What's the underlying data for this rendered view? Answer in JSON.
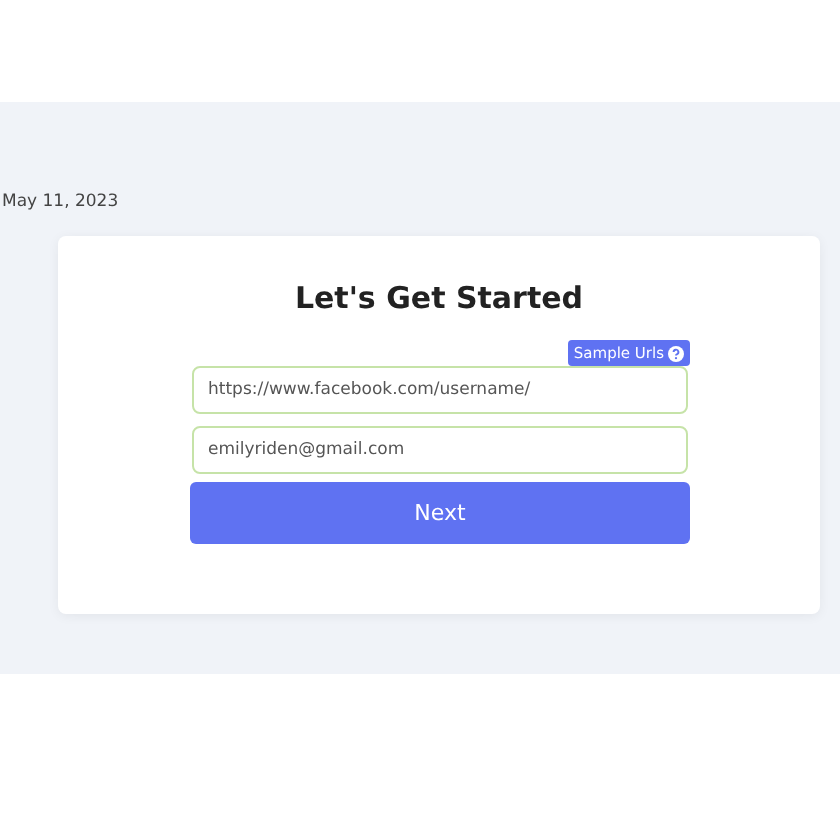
{
  "date": "May 11, 2023",
  "form": {
    "title": "Let's Get Started",
    "sample_urls": "Sample Urls",
    "fields": [
      {
        "placeholder": "https://www.facebook.com/username/"
      },
      {
        "placeholder": "emilyriden@gmail.com"
      }
    ],
    "submit": "Next"
  }
}
